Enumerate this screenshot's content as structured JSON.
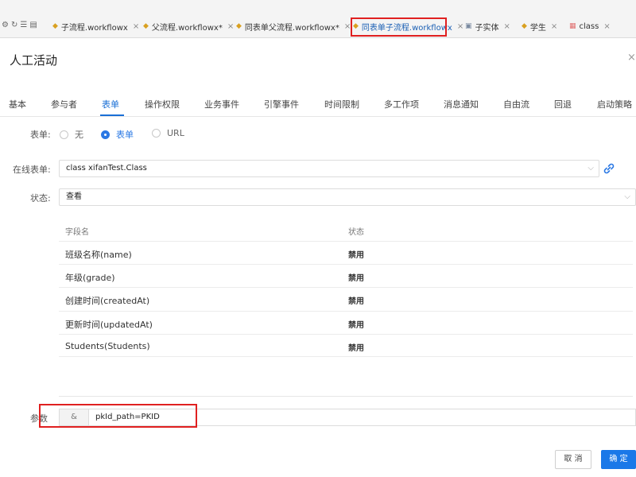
{
  "file_tabs": [
    {
      "label": "子流程.workflowx",
      "icon": "workflow-icon"
    },
    {
      "label": "父流程.workflowx*",
      "icon": "workflow-icon"
    },
    {
      "label": "同表单父流程.workflowx*",
      "icon": "workflow-icon"
    },
    {
      "label": "同表单子流程.workflowx",
      "icon": "workflow-icon",
      "active": true
    },
    {
      "label": "子实体",
      "icon": "entity-icon"
    },
    {
      "label": "学生",
      "icon": "workflow-icon"
    },
    {
      "label": "class",
      "icon": "class-icon"
    }
  ],
  "dialog": {
    "title": "人工活动",
    "close_glyph": "×"
  },
  "tabs": [
    "基本",
    "参与者",
    "表单",
    "操作权限",
    "业务事件",
    "引擎事件",
    "时间限制",
    "多工作项",
    "消息通知",
    "自由流",
    "回退",
    "启动策略"
  ],
  "active_tab": "表单",
  "form_type": {
    "label": "表单:",
    "options": [
      "无",
      "表单",
      "URL"
    ],
    "selected": "表单"
  },
  "online_form": {
    "label": "在线表单:",
    "value": "class xifanTest.Class"
  },
  "status": {
    "label": "状态:",
    "value": "查看"
  },
  "fields_table": {
    "headers": [
      "字段名",
      "状态"
    ],
    "rows": [
      {
        "name": "班级名称(name)",
        "state": "禁用"
      },
      {
        "name": "年级(grade)",
        "state": "禁用"
      },
      {
        "name": "创建时间(createdAt)",
        "state": "禁用"
      },
      {
        "name": "更新时间(updatedAt)",
        "state": "禁用"
      },
      {
        "name": "Students(Students)",
        "state": "禁用"
      }
    ]
  },
  "params": {
    "label": "参数",
    "prefix": "&",
    "value": "pkId_path=PKID"
  },
  "buttons": {
    "cancel": "取 消",
    "ok": "确 定"
  },
  "colors": {
    "accent": "#1a78e8",
    "highlight_box": "#e02020"
  }
}
